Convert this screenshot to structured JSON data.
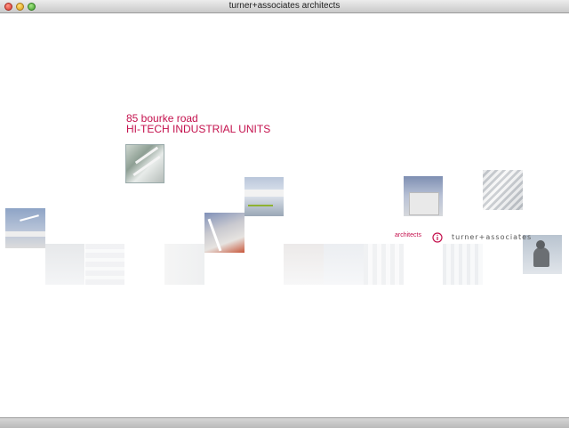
{
  "window": {
    "title": "turner+associates architects"
  },
  "heading": {
    "line1": "85 bourke road",
    "line2": "HI-TECH INDUSTRIAL UNITS"
  },
  "nav": {
    "architects_link": "architects"
  },
  "brand": {
    "logo_text": "turner+associates"
  },
  "colors": {
    "accent": "#c4114d"
  },
  "icons": {
    "info": "info-icon"
  }
}
